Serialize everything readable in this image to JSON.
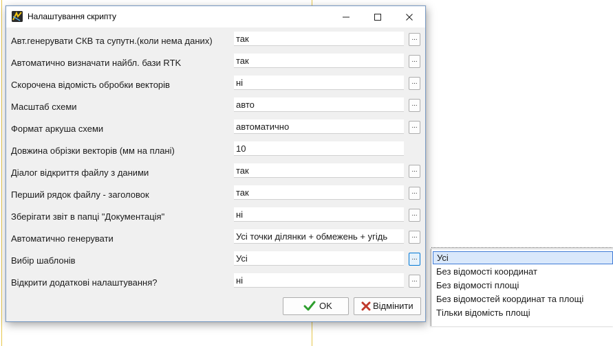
{
  "window": {
    "title": "Налаштування скрипту",
    "icon": "app-script-icon"
  },
  "settings": [
    {
      "label": "Авт.генерувати СКВ та супутн.(коли нема даних)",
      "value": "так",
      "has_button": true
    },
    {
      "label": "Автоматично визначати найбл. бази RTK",
      "value": "так",
      "has_button": true
    },
    {
      "label": "Скорочена відомість обробки векторів",
      "value": "ні",
      "has_button": true
    },
    {
      "label": "Масштаб схеми",
      "value": "авто",
      "has_button": true
    },
    {
      "label": "Формат аркуша схеми",
      "value": "автоматично",
      "has_button": true
    },
    {
      "label": "Довжина обрізки векторів (мм на плані)",
      "value": "10",
      "has_button": false
    },
    {
      "label": "Діалог відкриття файлу з даними",
      "value": "так",
      "has_button": true
    },
    {
      "label": "Перший рядок файлу - заголовок",
      "value": "так",
      "has_button": true
    },
    {
      "label": "Зберігати звіт в папці \"Документація\"",
      "value": "ні",
      "has_button": true
    },
    {
      "label": "Автоматично генерувати",
      "value": "Усі точки ділянки + обмежень + угідь",
      "has_button": true
    },
    {
      "label": "Вибір шаблонів",
      "value": "Усі",
      "has_button": true,
      "active": true
    },
    {
      "label": "Відкрити додаткові налаштування?",
      "value": "ні",
      "has_button": true
    }
  ],
  "ellipsis": "...",
  "buttons": {
    "ok_label": "OK",
    "cancel_label": "Відмінити"
  },
  "dropdown": {
    "options": [
      "Усі",
      "Без відомості координат",
      "Без відомості площі",
      "Без відомостей координат та площі",
      "Тільки відомість площі"
    ],
    "selected": "Усі"
  },
  "colors": {
    "accent": "#0078d7",
    "ok_check": "#2e9e2e",
    "cancel_x": "#c0392b",
    "selection": "#d9e8fb"
  }
}
